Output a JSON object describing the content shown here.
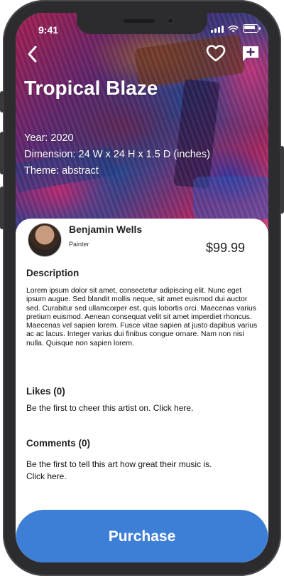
{
  "status_bar": {
    "time": "9:41"
  },
  "artwork": {
    "title": "Tropical Blaze",
    "year": "Year: 2020",
    "dimension": "Dimension: 24 W x 24 H x 1.5 D (inches)",
    "theme": "Theme: abstract"
  },
  "artist": {
    "name": "Benjamin Wells",
    "role": "Painter"
  },
  "price": "$99.99",
  "description": {
    "heading": "Description",
    "text": "Lorem ipsum dolor sit amet, consectetur adipiscing elit. Nunc eget ipsum augue. Sed blandit mollis neque, sit amet euismod dui auctor sed. Curabitur sed ullamcorper est, quis lobortis orci. Maecenas varius pretium euismod. Aenean consequat velit sit amet imperdiet rhoncus. Maecenas vel sapien lorem. Fusce vitae sapien at justo dapibus varius ac ac lacus. Integer varius dui finibus congue ornare. Nam non nisi nulla. Quisque non sapien lorem."
  },
  "likes": {
    "heading": "Likes (0)",
    "text": "Be the first to cheer this artist on. Click here."
  },
  "comments": {
    "heading": "Comments (0)",
    "text": "Be the first to tell this art how great their music is. Click here."
  },
  "purchase_button": "Purchase",
  "icons": {
    "back": "chevron-left-icon",
    "like": "heart-icon",
    "comment": "chat-plus-icon"
  }
}
